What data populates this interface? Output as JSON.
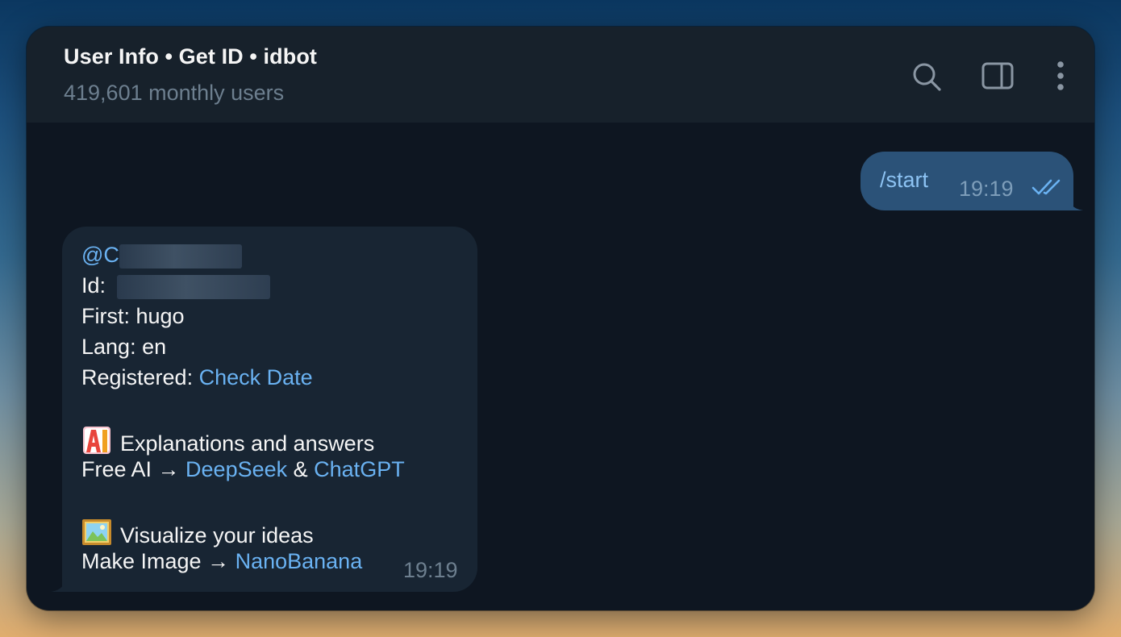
{
  "header": {
    "title": "User Info • Get ID • idbot",
    "subtitle": "419,601 monthly users",
    "icons": [
      "search-icon",
      "sidebar-toggle-icon",
      "more-vertical-icon"
    ]
  },
  "messages": {
    "outgoing": {
      "text": "/start",
      "time": "19:19",
      "status": "read"
    },
    "incoming": {
      "username_prefix": "@C",
      "id_label": "Id: ",
      "first_line": "First: hugo",
      "lang_line": "Lang: en",
      "registered_label": "Registered: ",
      "registered_link": "Check Date",
      "ai_emoji": "ai-icon",
      "ai_heading": "Explanations and answers",
      "free_ai_prefix": "Free AI → ",
      "deepseek_link": "DeepSeek",
      "amp": " & ",
      "chatgpt_link": "ChatGPT",
      "image_emoji": "framed-picture-icon",
      "visualize_heading": "Visualize your ideas",
      "make_image_prefix": "Make Image → ",
      "nanobanana_link": "NanoBanana",
      "time": "19:19"
    }
  },
  "colors": {
    "window_bg": "#0e1621",
    "header_bg": "#17212b",
    "outgoing_bubble": "#2b5278",
    "incoming_bubble": "#182533",
    "link": "#6ab2f2",
    "muted": "#6d7f8f"
  }
}
